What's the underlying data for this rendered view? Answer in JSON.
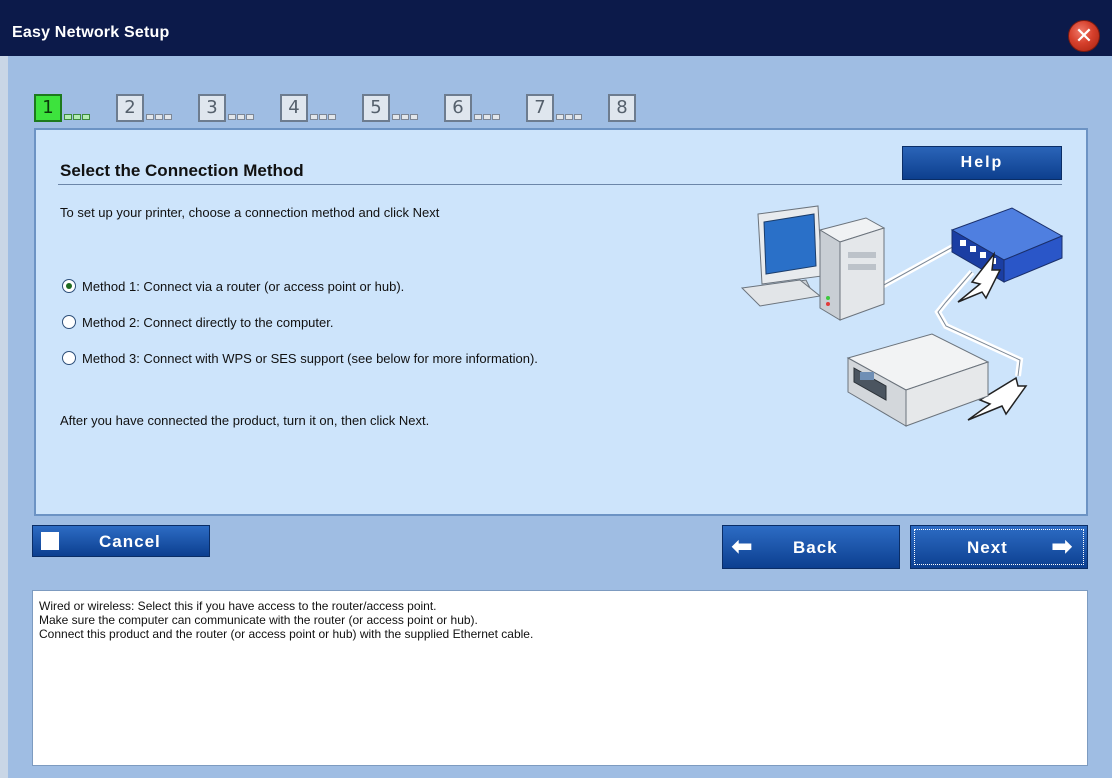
{
  "window": {
    "title": "Easy Network Setup",
    "close_icon": "close-icon"
  },
  "steps": {
    "active": 1,
    "items": [
      "1",
      "2",
      "3",
      "4",
      "5",
      "6",
      "7",
      "8"
    ]
  },
  "panel": {
    "title": "Select the Connection Method",
    "help_label": "Help",
    "intro": "To set up your printer, choose a connection method and click Next",
    "methods": [
      {
        "label": "Method 1: Connect via a router (or access point or hub).",
        "selected": true
      },
      {
        "label": "Method 2: Connect directly to the computer.",
        "selected": false
      },
      {
        "label": "Method 3: Connect with WPS or SES support (see below for more information).",
        "selected": false
      }
    ],
    "after": "After you have connected the product, turn it on, then click Next."
  },
  "buttons": {
    "cancel": "Cancel",
    "back": "Back",
    "next": "Next"
  },
  "info": {
    "lines": [
      "Wired or wireless: Select this if you have access to the router/access point.",
      "Make sure the computer can communicate with the router (or access point or hub).",
      "Connect this product and the router (or access point or hub) with the supplied Ethernet cable."
    ]
  },
  "colors": {
    "titlebar": "#0c1a4a",
    "background": "#9fbde3",
    "panel": "#cde4fb",
    "button": "#0c3f90",
    "active_step": "#3de33d"
  }
}
